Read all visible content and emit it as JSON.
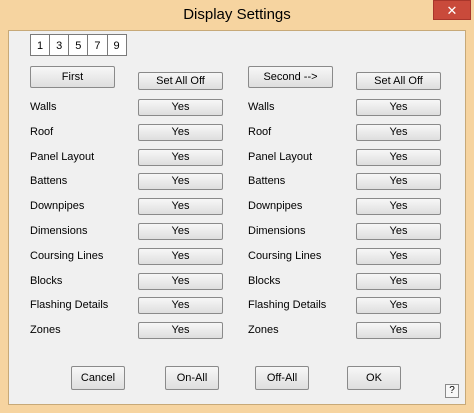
{
  "window": {
    "title": "Display Settings",
    "close_label": "✕"
  },
  "tabs": [
    "1",
    "3",
    "5",
    "7",
    "9"
  ],
  "left": {
    "group_button": "First",
    "set_all_off": "Set All Off"
  },
  "right": {
    "group_button": "Second -->",
    "set_all_off": "Set All Off"
  },
  "rows": [
    {
      "label": "Walls",
      "left": "Yes",
      "right": "Yes"
    },
    {
      "label": "Roof",
      "left": "Yes",
      "right": "Yes"
    },
    {
      "label": "Panel Layout",
      "left": "Yes",
      "right": "Yes"
    },
    {
      "label": "Battens",
      "left": "Yes",
      "right": "Yes"
    },
    {
      "label": "Downpipes",
      "left": "Yes",
      "right": "Yes"
    },
    {
      "label": "Dimensions",
      "left": "Yes",
      "right": "Yes"
    },
    {
      "label": "Coursing Lines",
      "left": "Yes",
      "right": "Yes"
    },
    {
      "label": "Blocks",
      "left": "Yes",
      "right": "Yes"
    },
    {
      "label": "Flashing Details",
      "left": "Yes",
      "right": "Yes"
    },
    {
      "label": "Zones",
      "left": "Yes",
      "right": "Yes"
    }
  ],
  "footer": {
    "cancel": "Cancel",
    "on_all": "On-All",
    "off_all": "Off-All",
    "ok": "OK"
  },
  "help_label": "?"
}
